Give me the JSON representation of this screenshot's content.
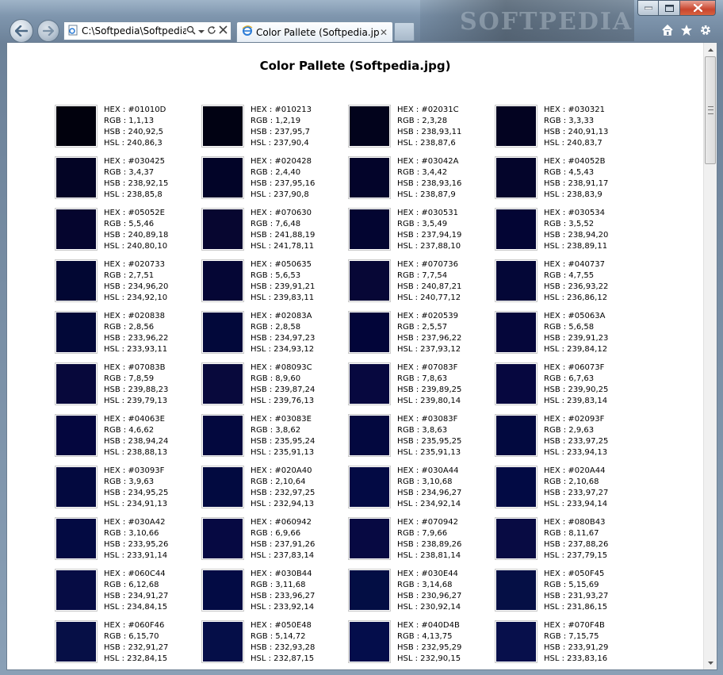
{
  "browser": {
    "address": "C:\\Softpedia\\Softpedia",
    "tab_title": "Color Pallete (Softpedia.jpg)",
    "tab_close": "✕",
    "brand_watermark": "SOFTPEDIA"
  },
  "page": {
    "title": "Color Pallete (Softpedia.jpg)"
  },
  "labels": {
    "hex": "HEX : ",
    "rgb": "RGB : ",
    "hsb": "HSB : ",
    "hsl": "HSL : "
  },
  "colors": [
    {
      "hex": "#01010D",
      "rgb": "1,1,13",
      "hsb": "240,92,5",
      "hsl": "240,86,3"
    },
    {
      "hex": "#010213",
      "rgb": "1,2,19",
      "hsb": "237,95,7",
      "hsl": "237,90,4"
    },
    {
      "hex": "#02031C",
      "rgb": "2,3,28",
      "hsb": "238,93,11",
      "hsl": "238,87,6"
    },
    {
      "hex": "#030321",
      "rgb": "3,3,33",
      "hsb": "240,91,13",
      "hsl": "240,83,7"
    },
    {
      "hex": "#030425",
      "rgb": "3,4,37",
      "hsb": "238,92,15",
      "hsl": "238,85,8"
    },
    {
      "hex": "#020428",
      "rgb": "2,4,40",
      "hsb": "237,95,16",
      "hsl": "237,90,8"
    },
    {
      "hex": "#03042A",
      "rgb": "3,4,42",
      "hsb": "238,93,16",
      "hsl": "238,87,9"
    },
    {
      "hex": "#04052B",
      "rgb": "4,5,43",
      "hsb": "238,91,17",
      "hsl": "238,83,9"
    },
    {
      "hex": "#05052E",
      "rgb": "5,5,46",
      "hsb": "240,89,18",
      "hsl": "240,80,10"
    },
    {
      "hex": "#070630",
      "rgb": "7,6,48",
      "hsb": "241,88,19",
      "hsl": "241,78,11"
    },
    {
      "hex": "#030531",
      "rgb": "3,5,49",
      "hsb": "237,94,19",
      "hsl": "237,88,10"
    },
    {
      "hex": "#030534",
      "rgb": "3,5,52",
      "hsb": "238,94,20",
      "hsl": "238,89,11"
    },
    {
      "hex": "#020733",
      "rgb": "2,7,51",
      "hsb": "234,96,20",
      "hsl": "234,92,10"
    },
    {
      "hex": "#050635",
      "rgb": "5,6,53",
      "hsb": "239,91,21",
      "hsl": "239,83,11"
    },
    {
      "hex": "#070736",
      "rgb": "7,7,54",
      "hsb": "240,87,21",
      "hsl": "240,77,12"
    },
    {
      "hex": "#040737",
      "rgb": "4,7,55",
      "hsb": "236,93,22",
      "hsl": "236,86,12"
    },
    {
      "hex": "#020838",
      "rgb": "2,8,56",
      "hsb": "233,96,22",
      "hsl": "233,93,11"
    },
    {
      "hex": "#02083A",
      "rgb": "2,8,58",
      "hsb": "234,97,23",
      "hsl": "234,93,12"
    },
    {
      "hex": "#020539",
      "rgb": "2,5,57",
      "hsb": "237,96,22",
      "hsl": "237,93,12"
    },
    {
      "hex": "#05063A",
      "rgb": "5,6,58",
      "hsb": "239,91,23",
      "hsl": "239,84,12"
    },
    {
      "hex": "#07083B",
      "rgb": "7,8,59",
      "hsb": "239,88,23",
      "hsl": "239,79,13"
    },
    {
      "hex": "#08093C",
      "rgb": "8,9,60",
      "hsb": "239,87,24",
      "hsl": "239,76,13"
    },
    {
      "hex": "#07083F",
      "rgb": "7,8,63",
      "hsb": "239,89,25",
      "hsl": "239,80,14"
    },
    {
      "hex": "#06073F",
      "rgb": "6,7,63",
      "hsb": "239,90,25",
      "hsl": "239,83,14"
    },
    {
      "hex": "#04063E",
      "rgb": "4,6,62",
      "hsb": "238,94,24",
      "hsl": "238,88,13"
    },
    {
      "hex": "#03083E",
      "rgb": "3,8,62",
      "hsb": "235,95,24",
      "hsl": "235,91,13"
    },
    {
      "hex": "#03083F",
      "rgb": "3,8,63",
      "hsb": "235,95,25",
      "hsl": "235,91,13"
    },
    {
      "hex": "#02093F",
      "rgb": "2,9,63",
      "hsb": "233,97,25",
      "hsl": "233,94,13"
    },
    {
      "hex": "#03093F",
      "rgb": "3,9,63",
      "hsb": "234,95,25",
      "hsl": "234,91,13"
    },
    {
      "hex": "#020A40",
      "rgb": "2,10,64",
      "hsb": "232,97,25",
      "hsl": "232,94,13"
    },
    {
      "hex": "#030A44",
      "rgb": "3,10,68",
      "hsb": "234,96,27",
      "hsl": "234,92,14"
    },
    {
      "hex": "#020A44",
      "rgb": "2,10,68",
      "hsb": "233,97,27",
      "hsl": "233,94,14"
    },
    {
      "hex": "#030A42",
      "rgb": "3,10,66",
      "hsb": "233,95,26",
      "hsl": "233,91,14"
    },
    {
      "hex": "#060942",
      "rgb": "6,9,66",
      "hsb": "237,91,26",
      "hsl": "237,83,14"
    },
    {
      "hex": "#070942",
      "rgb": "7,9,66",
      "hsb": "238,89,26",
      "hsl": "238,81,14"
    },
    {
      "hex": "#080B43",
      "rgb": "8,11,67",
      "hsb": "237,88,26",
      "hsl": "237,79,15"
    },
    {
      "hex": "#060C44",
      "rgb": "6,12,68",
      "hsb": "234,91,27",
      "hsl": "234,84,15"
    },
    {
      "hex": "#030B44",
      "rgb": "3,11,68",
      "hsb": "233,96,27",
      "hsl": "233,92,14"
    },
    {
      "hex": "#030E44",
      "rgb": "3,14,68",
      "hsb": "230,96,27",
      "hsl": "230,92,14"
    },
    {
      "hex": "#050F45",
      "rgb": "5,15,69",
      "hsb": "231,93,27",
      "hsl": "231,86,15"
    },
    {
      "hex": "#060F46",
      "rgb": "6,15,70",
      "hsb": "232,91,27",
      "hsl": "232,84,15"
    },
    {
      "hex": "#050E48",
      "rgb": "5,14,72",
      "hsb": "232,93,28",
      "hsl": "232,87,15"
    },
    {
      "hex": "#040D4B",
      "rgb": "4,13,75",
      "hsb": "232,95,29",
      "hsl": "232,90,15"
    },
    {
      "hex": "#070F4B",
      "rgb": "7,15,75",
      "hsb": "233,91,29",
      "hsl": "233,83,16"
    }
  ]
}
